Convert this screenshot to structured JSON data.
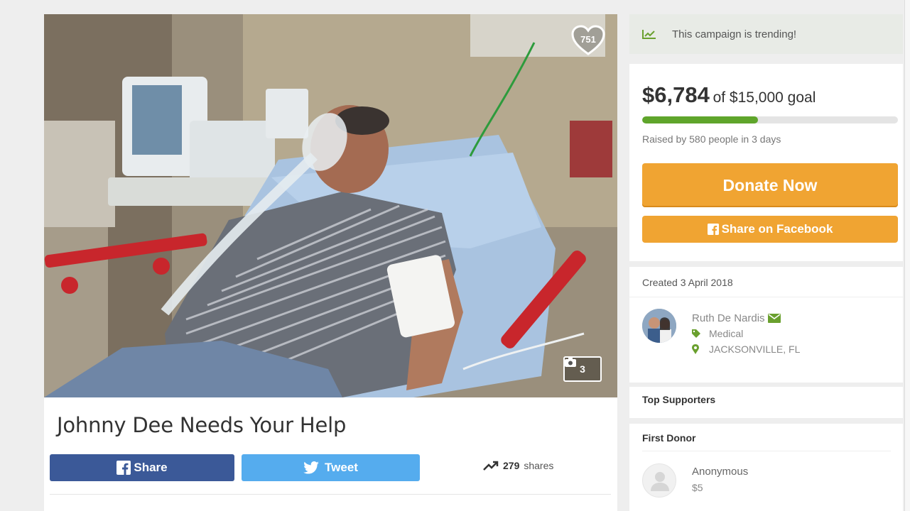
{
  "campaign": {
    "title": "Johnny Dee Needs Your Help",
    "like_count": "751",
    "photo_count": "3"
  },
  "share": {
    "facebook_label": "Share",
    "tweet_label": "Tweet",
    "share_count": "279",
    "shares_label": "shares"
  },
  "sidebar": {
    "trending_text": "This campaign is trending!",
    "raised_amount": "$6,784",
    "goal_text": "of $15,000 goal",
    "progress_fraction": 0.452,
    "raised_by": "Raised by 580 people in 3 days",
    "donate_label": "Donate Now",
    "share_facebook_label": "Share on Facebook",
    "created": "Created 3 April 2018",
    "organizer_name": "Ruth De Nardis",
    "category": "Medical",
    "location": "JACKSONVILLE, FL",
    "top_supporters": "Top Supporters",
    "first_donor_title": "First Donor",
    "first_donor_name": "Anonymous",
    "first_donor_amount": "$5"
  },
  "colors": {
    "accent": "#f0a432",
    "progress": "#5fa52b",
    "facebook": "#3b5998",
    "twitter": "#55acee",
    "icon_green": "#6aa02e"
  },
  "icons": [
    "heart-icon",
    "camera-icon",
    "facebook-icon",
    "twitter-icon",
    "trending-icon",
    "envelope-icon",
    "tag-icon",
    "location-pin-icon",
    "user-icon"
  ]
}
